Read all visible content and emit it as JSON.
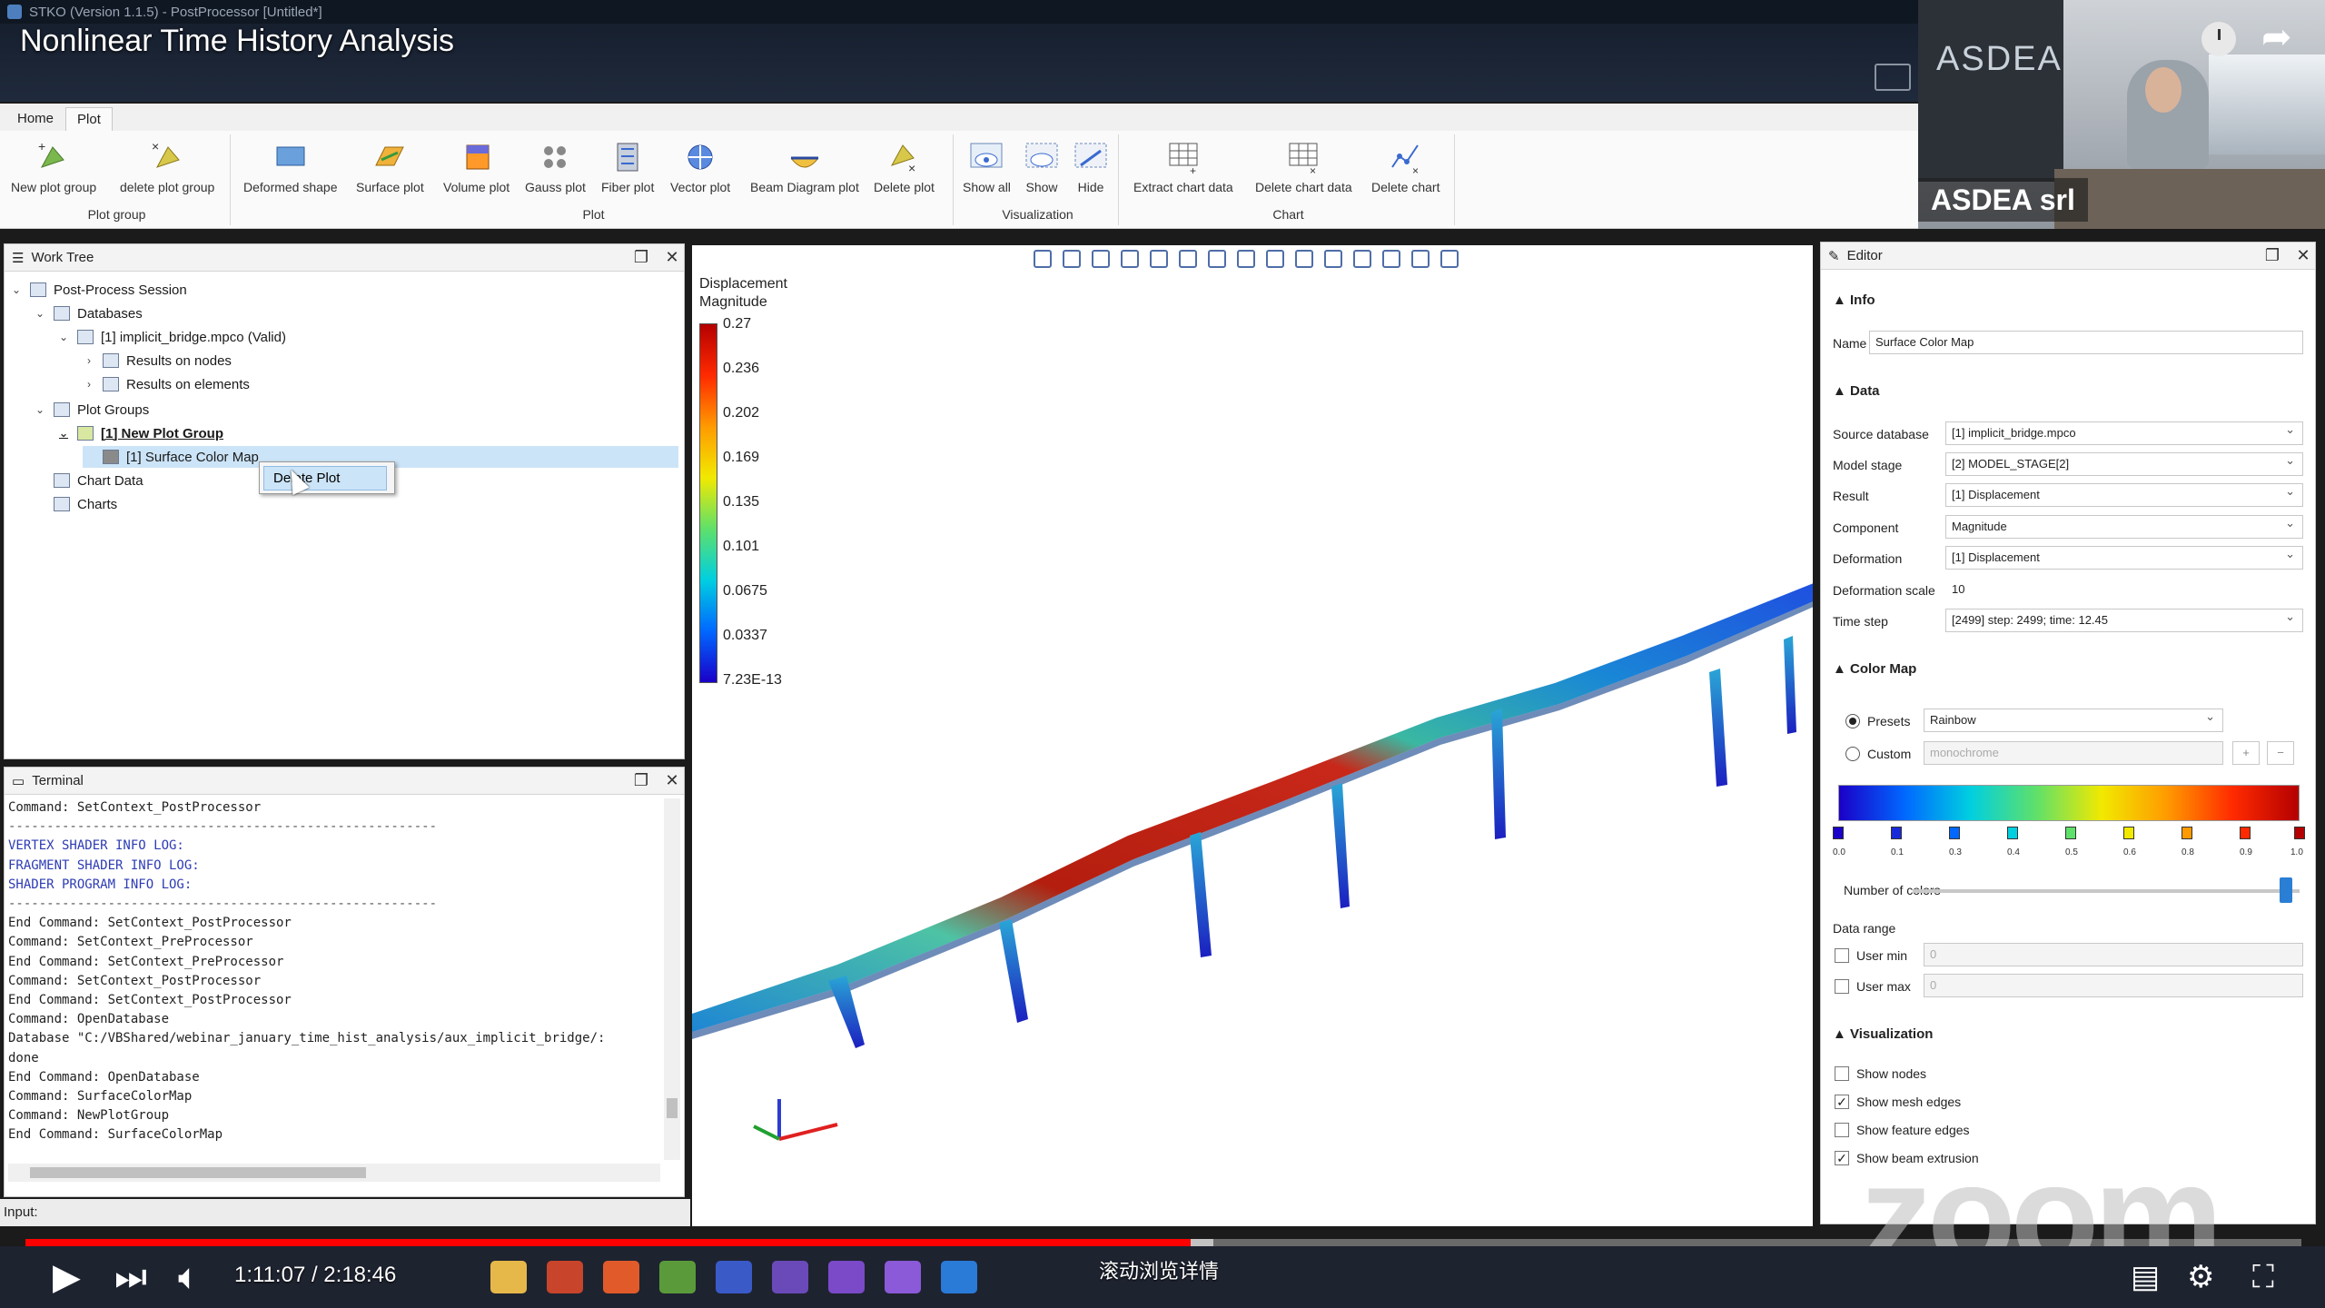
{
  "window": {
    "app_title": "STKO (Version 1.1.5) - PostProcessor [Untitled*]"
  },
  "video": {
    "title": "Nonlinear Time History Analysis",
    "webcam_brand": "ASDEA",
    "webcam_name": "ASDEA srl",
    "watermark": "zoom"
  },
  "ribbon": {
    "tabs": [
      "Home",
      "Plot"
    ],
    "active_tab": "Plot",
    "groups": [
      {
        "label": "Plot group",
        "buttons": [
          "New plot group",
          "delete plot group"
        ]
      },
      {
        "label": "Plot",
        "buttons": [
          "Deformed shape",
          "Surface plot",
          "Volume plot",
          "Gauss plot",
          "Fiber plot",
          "Vector plot",
          "Beam Diagram plot",
          "Delete plot"
        ]
      },
      {
        "label": "Visualization",
        "buttons": [
          "Show all",
          "Show",
          "Hide"
        ]
      },
      {
        "label": "Chart",
        "buttons": [
          "Extract chart data",
          "Delete chart data",
          "Delete chart"
        ]
      }
    ]
  },
  "worktree": {
    "title": "Work Tree",
    "nodes": {
      "session": "Post-Process Session",
      "databases": "Databases",
      "db1": "[1] implicit_bridge.mpco (Valid)",
      "nodes_res": "Results on nodes",
      "elem_res": "Results on elements",
      "plot_groups": "Plot Groups",
      "group1": "[1] New Plot Group",
      "plot1": "[1] Surface Color Map",
      "chart_data": "Chart Data",
      "charts": "Charts"
    },
    "context_menu": "Delete Plot"
  },
  "terminal": {
    "title": "Terminal",
    "lines": [
      "Command: SetContext_PostProcessor",
      "--------------------------------------------------------",
      "VERTEX SHADER INFO LOG:",
      "FRAGMENT SHADER INFO LOG:",
      "SHADER PROGRAM INFO LOG:",
      "--------------------------------------------------------",
      "End Command: SetContext_PostProcessor",
      "Command: SetContext_PreProcessor",
      "End Command: SetContext_PreProcessor",
      "Command: SetContext_PostProcessor",
      "End Command: SetContext_PostProcessor",
      "Command: OpenDatabase",
      "Database \"C:/VBShared/webinar_january_time_hist_analysis/aux_implicit_bridge/:",
      "done",
      "End Command: OpenDatabase",
      "Command: SurfaceColorMap",
      "Command: NewPlotGroup",
      "End Command: SurfaceColorMap"
    ],
    "input_label": "Input:"
  },
  "viewport": {
    "legend_title_1": "Displacement",
    "legend_title_2": "Magnitude",
    "legend_ticks": [
      "0.27",
      "0.236",
      "0.202",
      "0.169",
      "0.135",
      "0.101",
      "0.0675",
      "0.0337",
      "7.23E-13"
    ]
  },
  "editor": {
    "title": "Editor",
    "info_section": "Info",
    "name_label": "Name",
    "name_value": "Surface Color Map",
    "data_section": "Data",
    "fields": [
      {
        "label": "Source database",
        "value": "[1] implicit_bridge.mpco"
      },
      {
        "label": "Model stage",
        "value": "[2] MODEL_STAGE[2]"
      },
      {
        "label": "Result",
        "value": "[1] Displacement"
      },
      {
        "label": "Component",
        "value": "Magnitude"
      },
      {
        "label": "Deformation",
        "value": "[1] Displacement"
      },
      {
        "label": "Deformation scale",
        "value": "10"
      },
      {
        "label": "Time step",
        "value": "[2499] step: 2499; time: 12.45"
      }
    ],
    "colormap_section": "Color Map",
    "presets_label": "Presets",
    "presets_value": "Rainbow",
    "custom_label": "Custom",
    "custom_value": "monochrome",
    "stops": [
      "0.0",
      "0.1",
      "0.3",
      "0.4",
      "0.5",
      "0.6",
      "0.8",
      "0.9",
      "1.0"
    ],
    "num_colors_label": "Number of colors",
    "data_range_label": "Data range",
    "user_min_label": "User min",
    "user_min_value": "0",
    "user_max_label": "User max",
    "user_max_value": "0",
    "vis_section": "Visualization",
    "show_nodes": "Show nodes",
    "show_mesh_edges": "Show mesh edges",
    "show_feature_edges": "Show feature edges",
    "show_beam_extrusion": "Show beam extrusion"
  },
  "player": {
    "time": "1:11:07 / 2:18:46",
    "played_fraction": 0.512,
    "caption": "滚动浏览详情"
  }
}
